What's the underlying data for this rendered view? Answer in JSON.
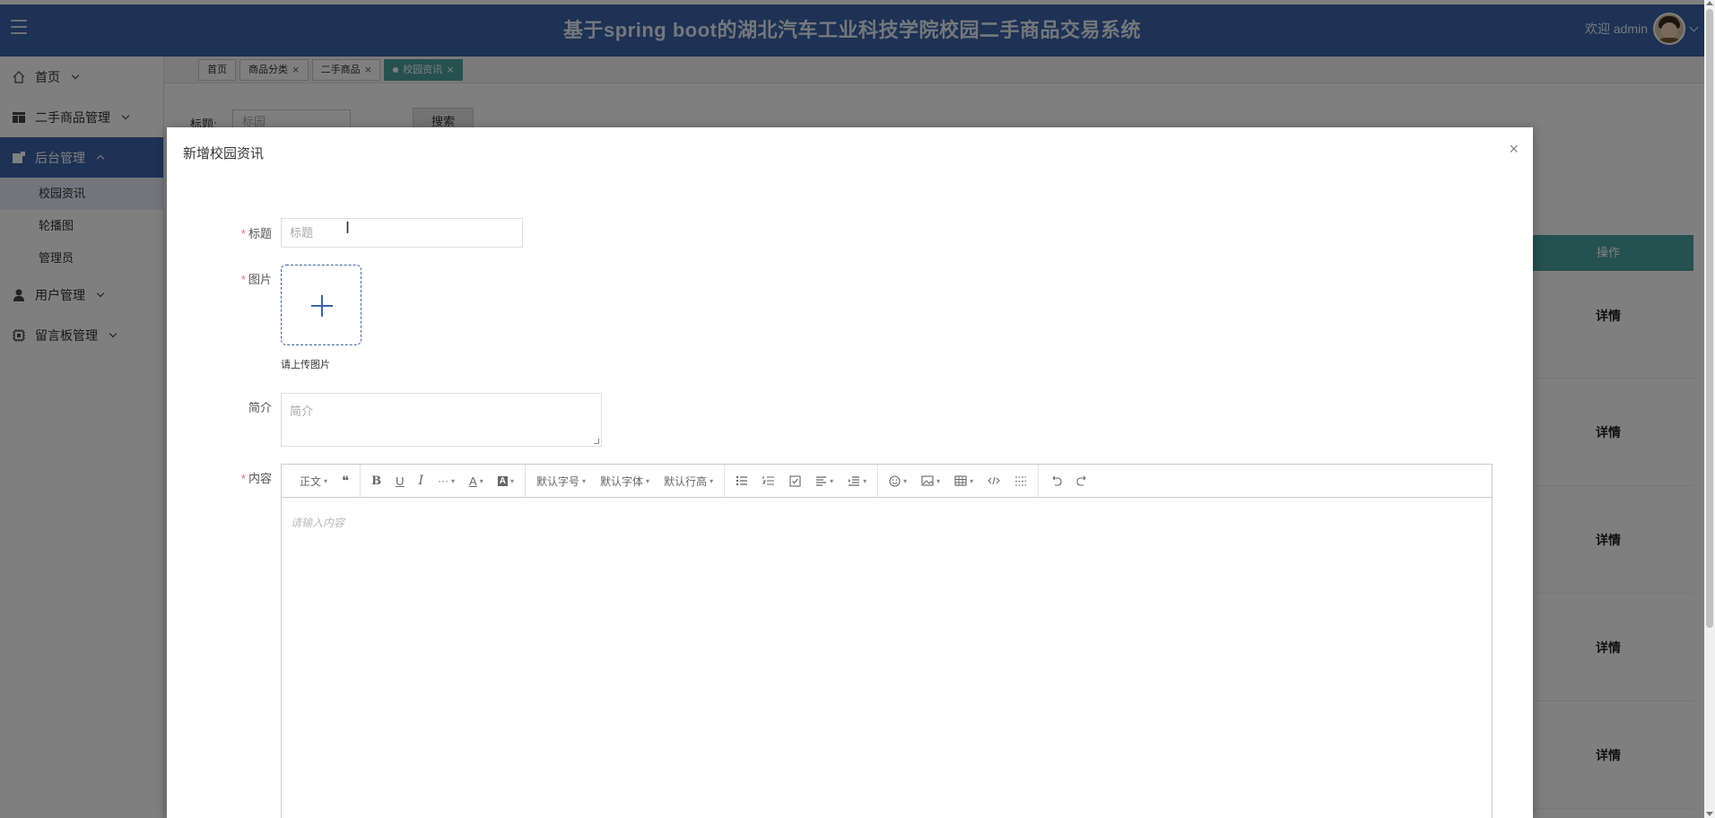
{
  "header": {
    "title": "基于spring boot的湖北汽车工业科技学院校园二手商品交易系统",
    "welcome": "欢迎 admin"
  },
  "sidebar": {
    "items": [
      {
        "label": "首页",
        "icon": "home-icon"
      },
      {
        "label": "二手商品管理",
        "icon": "layout-icon"
      },
      {
        "label": "后台管理",
        "icon": "admin-icon"
      },
      {
        "label": "用户管理",
        "icon": "user-icon"
      },
      {
        "label": "留言板管理",
        "icon": "chip-icon"
      }
    ],
    "sub_items": [
      "校园资讯",
      "轮播图",
      "管理员"
    ]
  },
  "tabs": [
    {
      "label": "首页"
    },
    {
      "label": "商品分类",
      "close": "×"
    },
    {
      "label": "二手商品",
      "close": "×"
    },
    {
      "label": "校园资讯",
      "close": "×"
    }
  ],
  "search": {
    "label": "标题:",
    "placeholder": "标园",
    "button": "搜索"
  },
  "table": {
    "ops_header": "操作",
    "row_action": "详情"
  },
  "modal": {
    "title": "新增校园资讯",
    "close": "×",
    "required_mark": "*",
    "fields": {
      "title_label": "标题",
      "title_placeholder": "标题",
      "image_label": "图片",
      "upload_hint": "请上传图片",
      "desc_label": "简介",
      "desc_placeholder": "简介",
      "content_label": "内容"
    }
  },
  "editor": {
    "placeholder": "请输入内容",
    "toolbar": {
      "paragraph": "正文",
      "quote": "❝",
      "bold": "B",
      "underline": "U",
      "italic": "I",
      "more": "···",
      "font_color": "A",
      "bg_color": "A",
      "font_size": "默认字号",
      "font_family": "默认字体",
      "line_height": "默认行高"
    }
  },
  "colors": {
    "primary": "#3a64a8",
    "tab_active": "#4aa3a1",
    "required": "#f56c6c"
  }
}
